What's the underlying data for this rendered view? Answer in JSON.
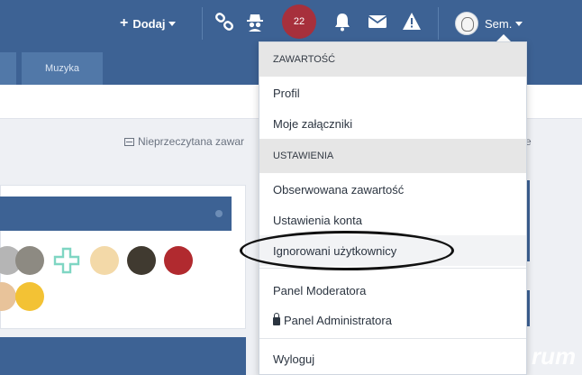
{
  "nav": {
    "add_label": "Dodaj",
    "notification_count": "22",
    "username": "Sem.",
    "tabs": [
      {
        "label": "Muzyka"
      }
    ]
  },
  "unread": {
    "label": "Nieprzeczytana zawar",
    "right_fragment": "e"
  },
  "watermark": "rum",
  "dropdown": {
    "section_content": "ZAWARTOŚĆ",
    "section_settings": "USTAWIENIA",
    "items": {
      "profile": "Profil",
      "attachments": "Moje załączniki",
      "followed": "Obserwowana zawartość",
      "account_settings": "Ustawienia konta",
      "ignored_users": "Ignorowani użytkownicy",
      "moderator_panel": "Panel Moderatora",
      "admin_panel": "Panel Administratora",
      "logout": "Wyloguj"
    }
  },
  "icons": [
    "plus-icon",
    "link-icon",
    "spy-icon",
    "bell-icon",
    "envelope-icon",
    "warning-icon",
    "lock-icon"
  ],
  "colors": {
    "nav_blue": "#3d6294",
    "badge_red": "#a7303c",
    "header_gray": "#e6e6e6"
  }
}
